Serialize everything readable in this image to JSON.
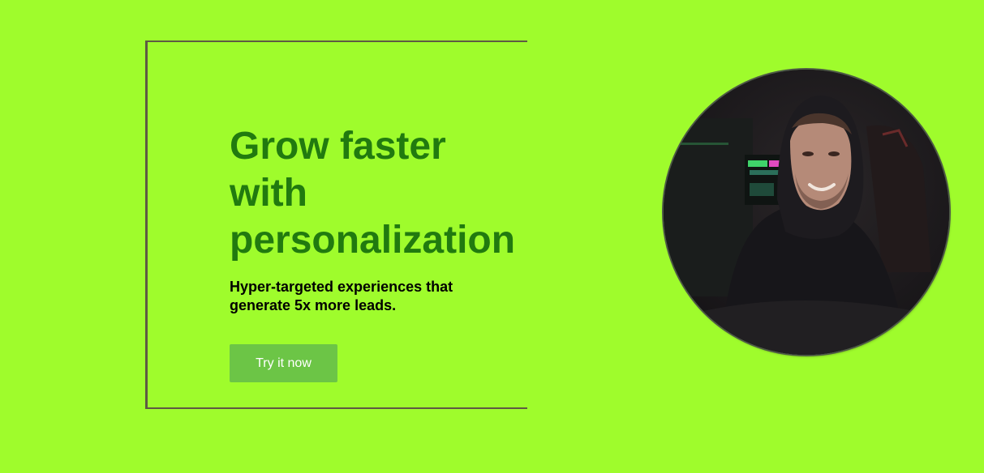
{
  "hero": {
    "headline_lines": [
      "Grow faster",
      "with",
      "personalization"
    ],
    "subheadline": "Hyper-targeted experiences that generate 5x more leads.",
    "cta_label": "Try it now"
  },
  "colors": {
    "background": "#9ffc2c",
    "headline": "#217a0f",
    "button": "#6cc546",
    "frame": "#5e5a43"
  },
  "image": {
    "icon": "person-photo"
  }
}
